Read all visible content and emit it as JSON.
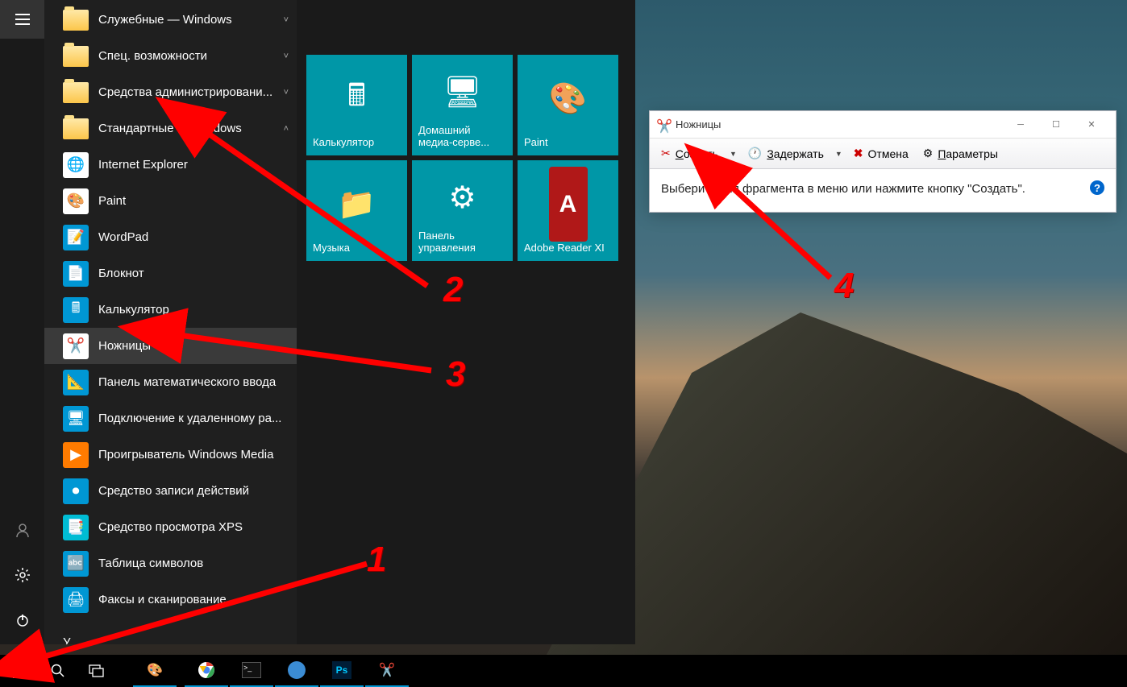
{
  "start_menu": {
    "folders": [
      {
        "label": "Служебные — Windows",
        "chevron": "˅"
      },
      {
        "label": "Спец. возможности",
        "chevron": "˅"
      },
      {
        "label": "Средства администрировани...",
        "chevron": "˅"
      },
      {
        "label": "Стандартные — Windows",
        "chevron": "˄"
      }
    ],
    "apps": [
      {
        "label": "Internet Explorer",
        "icon": "ie",
        "color": "#1e88e5"
      },
      {
        "label": "Paint",
        "icon": "paint",
        "color": "#f0b030"
      },
      {
        "label": "WordPad",
        "icon": "wordpad",
        "color": "#0097d4"
      },
      {
        "label": "Блокнот",
        "icon": "notepad",
        "color": "#0097d4"
      },
      {
        "label": "Калькулятор",
        "icon": "calc",
        "color": "#0097d4"
      },
      {
        "label": "Ножницы",
        "icon": "snip",
        "color": "#0097d4",
        "highlighted": true
      },
      {
        "label": "Панель математического ввода",
        "icon": "math",
        "color": "#0097d4"
      },
      {
        "label": "Подключение к удаленному ра...",
        "icon": "rdp",
        "color": "#0097d4"
      },
      {
        "label": "Проигрыватель Windows Media",
        "icon": "wmp",
        "color": "#ff7b00"
      },
      {
        "label": "Средство записи действий",
        "icon": "psr",
        "color": "#0097d4"
      },
      {
        "label": "Средство просмотра XPS",
        "icon": "xps",
        "color": "#00bcd4"
      },
      {
        "label": "Таблица символов",
        "icon": "charmap",
        "color": "#0097d4"
      },
      {
        "label": "Факсы и сканирование",
        "icon": "fax",
        "color": "#0097d4"
      }
    ],
    "bottom_letter": "У",
    "tiles": [
      {
        "label": "Калькулятор",
        "icon": "🖩"
      },
      {
        "label": "Домашний медиа-серве...",
        "icon": "🖥"
      },
      {
        "label": "Paint",
        "icon": "🎨"
      },
      {
        "label": "Музыка",
        "icon": "📁"
      },
      {
        "label": "Панель управления",
        "icon": "⚙"
      },
      {
        "label": "Adobe Reader XI",
        "icon": "A",
        "bg": "#b01818"
      }
    ]
  },
  "snipping_tool": {
    "title": "Ножницы",
    "toolbar": {
      "create": "Создать",
      "delay": "Задержать",
      "cancel": "Отмена",
      "params": "Параметры"
    },
    "message": "Выберите тип фрагмента в меню или нажмите кнопку \"Создать\"."
  },
  "annotations": {
    "n1": "1",
    "n2": "2",
    "n3": "3",
    "n4": "4"
  },
  "taskbar_apps": [
    "paint",
    "chrome",
    "cmd",
    "toolbox",
    "ps",
    "snip"
  ]
}
